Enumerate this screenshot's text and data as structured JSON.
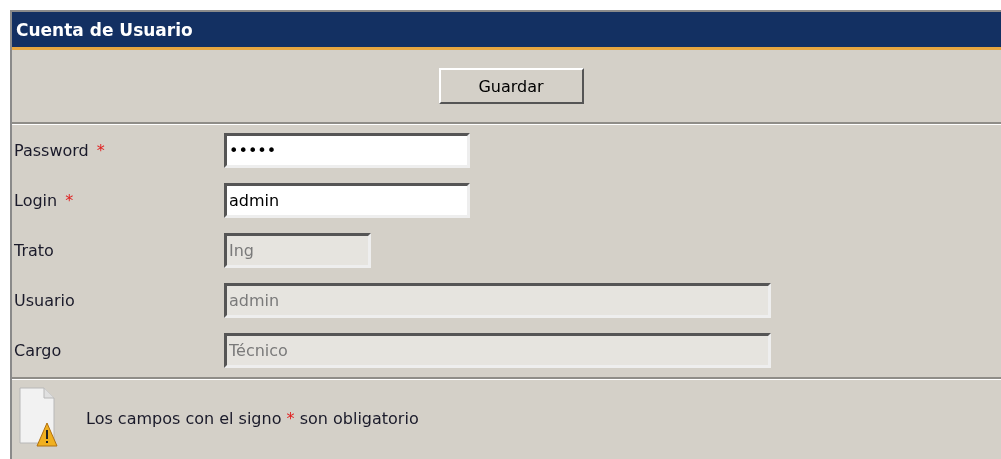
{
  "window": {
    "title": "Cuenta de Usuario"
  },
  "toolbar": {
    "buttons": [
      {
        "label": "Guardar"
      }
    ]
  },
  "fields": [
    {
      "label": "Password",
      "required_mark": "*",
      "value": "•••••",
      "disabled": false
    },
    {
      "label": "Login",
      "required_mark": "*",
      "value": "admin",
      "disabled": false
    },
    {
      "label": "Trato",
      "value": "Ing",
      "disabled": true
    },
    {
      "label": "Usuario",
      "value": "admin",
      "disabled": true
    },
    {
      "label": "Cargo",
      "value": "Técnico",
      "disabled": true
    }
  ],
  "note": {
    "text_before": "Los campos con el signo",
    "mark": "*",
    "text_after": "son obligatorio"
  }
}
